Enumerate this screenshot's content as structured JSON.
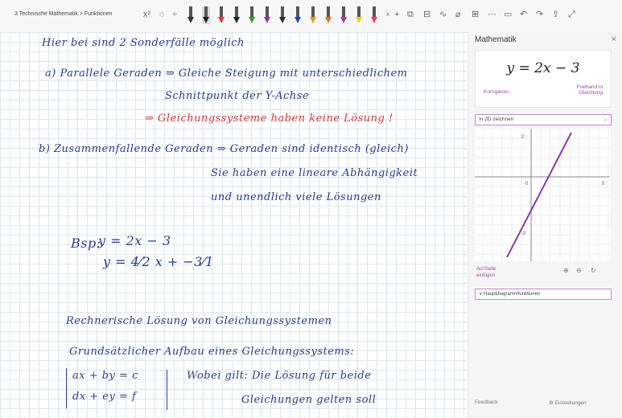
{
  "toolbar": {
    "breadcrumb": "3 Technische Mathematik > Funktionen",
    "pens": [
      {
        "color": "#333333"
      },
      {
        "color": "#222222",
        "selected": true
      },
      {
        "color": "#e03a3a"
      },
      {
        "color": "#222222"
      },
      {
        "color": "#3a9a3a"
      },
      {
        "color": "#8a3aa0"
      },
      {
        "color": "#2a2a2a"
      },
      {
        "color": "#1f4aa8"
      },
      {
        "color": "#d0a020"
      },
      {
        "color": "#e07030"
      },
      {
        "color": "#9a3aa0"
      },
      {
        "color": "#e8d020"
      },
      {
        "color": "#e04080"
      }
    ]
  },
  "notes": {
    "line1": "Hier bei sind 2 Sonderfälle möglich",
    "line2": "a) Parallele Geraden ⇒ Gleiche Steigung mit unterschiedlichem",
    "line3": "Schnittpunkt der Y-Achse",
    "line4": "⇒ Gleichungssysteme haben keine Lösung !",
    "line5": "b) Zusammenfallende Geraden ⇒ Geraden sind identisch (gleich)",
    "line6": "Sie haben eine lineare Abhängigkeit",
    "line7": "und unendlich viele Lösungen",
    "bsp_label": "Bsp:",
    "bsp_eq1": "y = 2x − 3",
    "bsp_eq2": "y = 4⁄2 x + −3⁄1",
    "line8": "Rechnerische Lösung von Gleichungssystemen",
    "line9": "Grundsätzlicher Aufbau eines Gleichungssystems:",
    "sys1": "ax + by = c",
    "sys2": "dx + ey = f",
    "note1": "Wobei gilt: Die Lösung für beide",
    "note2": "Gleichungen gelten soll"
  },
  "panel": {
    "title": "Mathematik",
    "close": "×",
    "equation": "y = 2x − 3",
    "link_left": "Korrigieren",
    "link_right1": "Freihand in",
    "link_right2": "Gleichung",
    "dropdown": "In 2D zeichnen",
    "graph": {
      "tick_y_top": "2",
      "tick_origin": "0",
      "tick_x_right": "5",
      "tick_y_bottom": "-2",
      "line_color": "#8a3aa8"
    },
    "insert1": "Auf Seite",
    "insert2": "einfügen",
    "dropdown2": "∨ Hauptdiagrammfunktionen",
    "footer_left": "Feedback",
    "footer_right": "⚙ Einstellungen"
  }
}
